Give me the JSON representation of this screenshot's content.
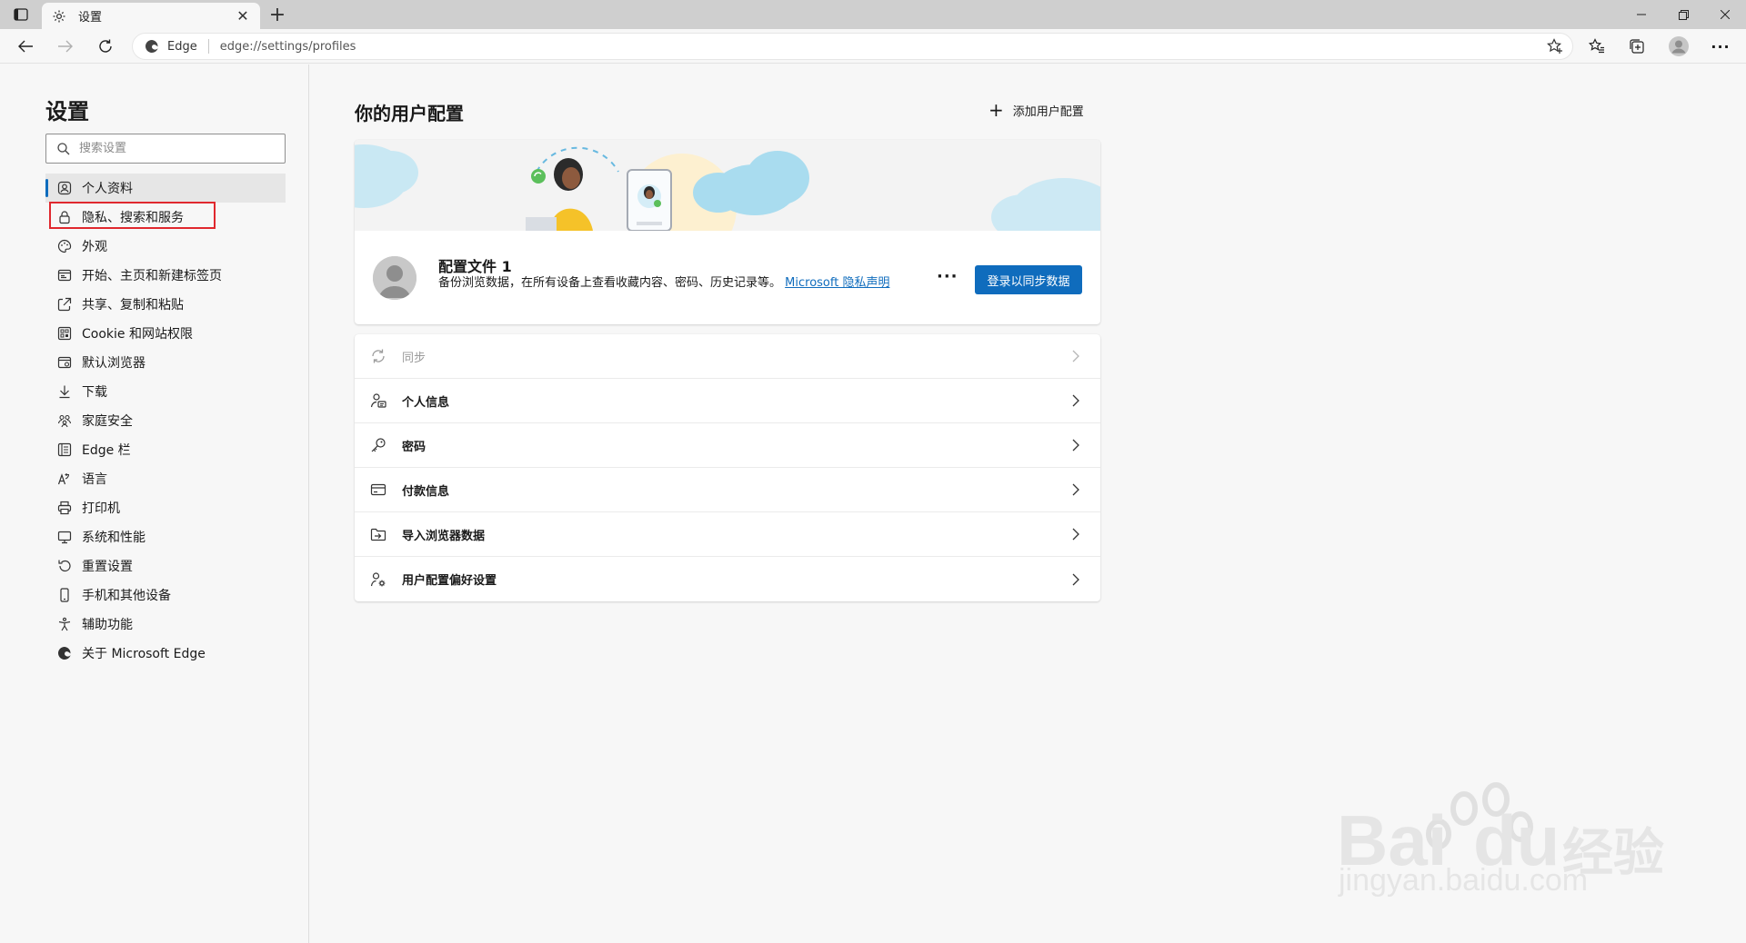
{
  "browser": {
    "tab_title": "设置",
    "address_label": "Edge",
    "url": "edge://settings/profiles"
  },
  "sidebar": {
    "title": "设置",
    "search_placeholder": "搜索设置",
    "items": [
      {
        "label": "个人资料",
        "icon": "profile-icon"
      },
      {
        "label": "隐私、搜索和服务",
        "icon": "lock-icon"
      },
      {
        "label": "外观",
        "icon": "appearance-icon"
      },
      {
        "label": "开始、主页和新建标签页",
        "icon": "home-icon"
      },
      {
        "label": "共享、复制和粘贴",
        "icon": "share-icon"
      },
      {
        "label": "Cookie 和网站权限",
        "icon": "cookie-icon"
      },
      {
        "label": "默认浏览器",
        "icon": "browser-icon"
      },
      {
        "label": "下载",
        "icon": "download-icon"
      },
      {
        "label": "家庭安全",
        "icon": "family-icon"
      },
      {
        "label": "Edge 栏",
        "icon": "edge-bar-icon"
      },
      {
        "label": "语言",
        "icon": "language-icon"
      },
      {
        "label": "打印机",
        "icon": "printer-icon"
      },
      {
        "label": "系统和性能",
        "icon": "system-icon"
      },
      {
        "label": "重置设置",
        "icon": "reset-icon"
      },
      {
        "label": "手机和其他设备",
        "icon": "phone-icon"
      },
      {
        "label": "辅助功能",
        "icon": "accessibility-icon"
      },
      {
        "label": "关于 Microsoft Edge",
        "icon": "edge-logo-icon"
      }
    ]
  },
  "main": {
    "title": "你的用户配置",
    "add_profile": "添加用户配置",
    "profile": {
      "name": "配置文件 1",
      "description": "备份浏览数据，在所有设备上查看收藏内容、密码、历史记录等。",
      "privacy_link": "Microsoft 隐私声明",
      "more": "···",
      "signin_button": "登录以同步数据"
    },
    "rows": [
      {
        "label": "同步",
        "icon": "sync-icon"
      },
      {
        "label": "个人信息",
        "icon": "personal-info-icon"
      },
      {
        "label": "密码",
        "icon": "key-icon"
      },
      {
        "label": "付款信息",
        "icon": "card-icon"
      },
      {
        "label": "导入浏览器数据",
        "icon": "import-icon"
      },
      {
        "label": "用户配置偏好设置",
        "icon": "profile-prefs-icon"
      }
    ]
  },
  "watermark": {
    "brand": "Bai",
    "brand2": "du",
    "cn": "经验",
    "url": "jingyan.baidu.com"
  },
  "colors": {
    "accent": "#0f6cbd",
    "highlight": "#e0282e",
    "cloud": "#a9dcef"
  }
}
